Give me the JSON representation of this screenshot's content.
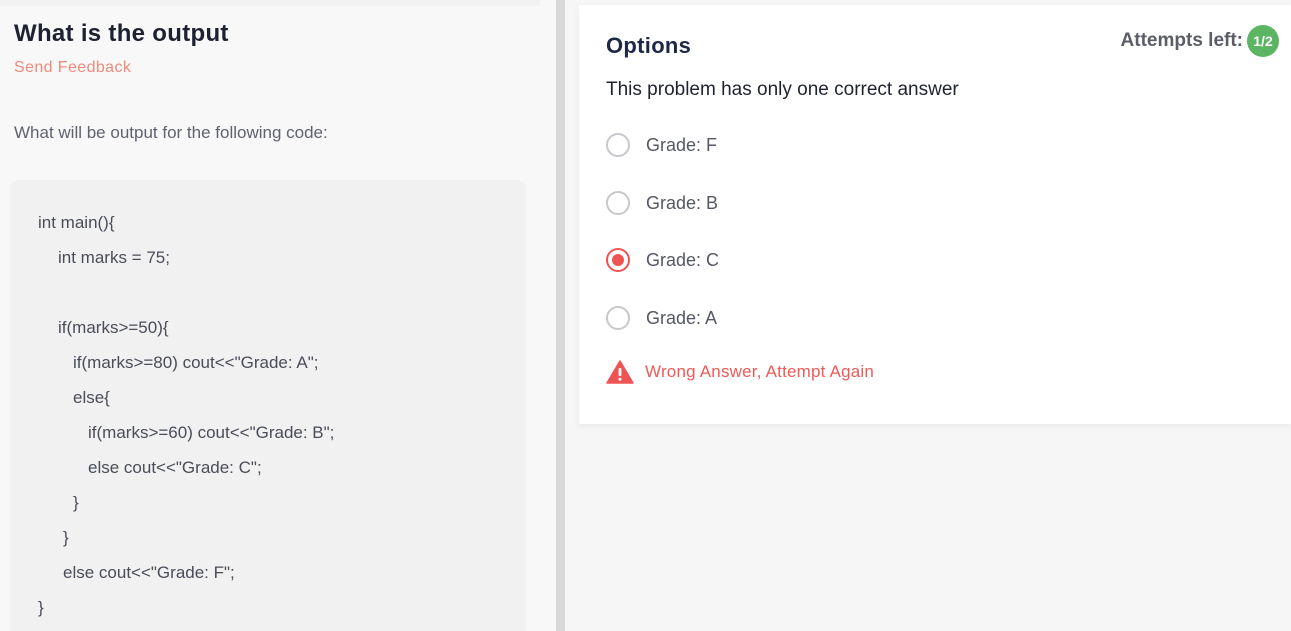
{
  "question": {
    "title": "What is the output",
    "feedback_link": "Send Feedback",
    "prompt": "What will be output for the following code:",
    "code_lines": [
      "int main(){",
      "int marks = 75;",
      "if(marks>=50){",
      "if(marks>=80) cout<<\"Grade: A\";",
      "else{",
      "if(marks>=60) cout<<\"Grade: B\";",
      "else cout<<\"Grade: C\";",
      "}",
      "}",
      "else cout<<\"Grade: F\";",
      "}"
    ]
  },
  "options_panel": {
    "title": "Options",
    "attempts_label": "Attempts left:",
    "attempts_value": "1/2",
    "subtitle": "This problem has only one correct answer",
    "options": [
      {
        "label": "Grade: F",
        "selected": false
      },
      {
        "label": "Grade: B",
        "selected": false
      },
      {
        "label": "Grade: C",
        "selected": true
      },
      {
        "label": "Grade: A",
        "selected": false
      }
    ],
    "error_message": "Wrong Answer, Attempt Again"
  },
  "colors": {
    "accent_red": "#ee5454",
    "feedback_link": "#f08a7c",
    "badge_green": "#5bb563"
  },
  "icons": {
    "warning": "warning-triangle-icon"
  }
}
